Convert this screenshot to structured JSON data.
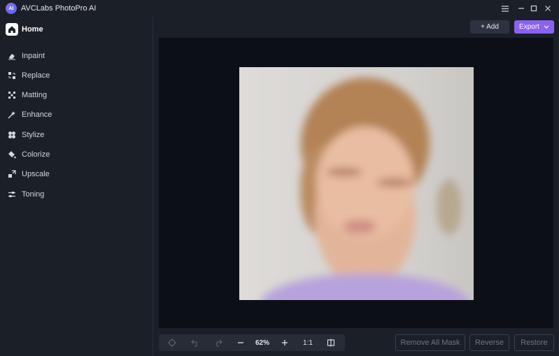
{
  "app": {
    "title": "AVCLabs PhotoPro AI",
    "logo_text": "AI"
  },
  "sidebar": {
    "home_label": "Home",
    "items": [
      {
        "label": "Inpaint",
        "icon": "eraser-icon"
      },
      {
        "label": "Replace",
        "icon": "replace-icon"
      },
      {
        "label": "Matting",
        "icon": "matting-icon"
      },
      {
        "label": "Enhance",
        "icon": "enhance-icon"
      },
      {
        "label": "Stylize",
        "icon": "stylize-icon"
      },
      {
        "label": "Colorize",
        "icon": "paint-bucket-icon"
      },
      {
        "label": "Upscale",
        "icon": "upscale-icon"
      },
      {
        "label": "Toning",
        "icon": "sliders-icon"
      }
    ]
  },
  "header": {
    "add_label": "+ Add",
    "export_label": "Export"
  },
  "toolbar": {
    "zoom": "62%",
    "ratio": "1:1"
  },
  "actions": {
    "remove_all_mask": "Remove All Mask",
    "reverse": "Reverse",
    "restore": "Restore"
  },
  "colors": {
    "accent": "#8a62f2",
    "canvas_bg": "#0c1016",
    "sidebar_bg": "#1b1f28"
  }
}
